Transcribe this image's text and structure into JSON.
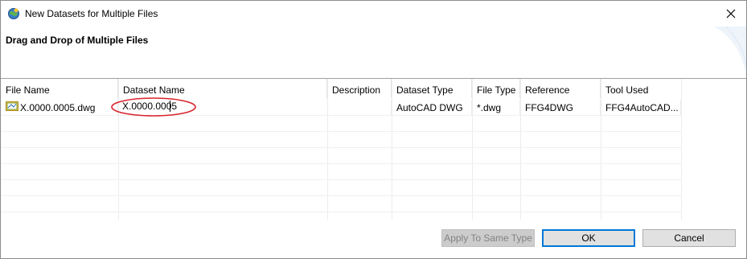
{
  "window": {
    "title": "New Datasets for Multiple Files",
    "icon": "globe-app-icon"
  },
  "header": {
    "title": "Drag and Drop of Multiple Files"
  },
  "table": {
    "columns": [
      "File Name",
      "Dataset Name",
      "Description",
      "Dataset Type",
      "File Type",
      "Reference",
      "Tool Used"
    ],
    "rows": [
      {
        "file_name": "X.0000.0005.dwg",
        "dataset_name": "X.0000.0005",
        "description": "",
        "dataset_type": "AutoCAD DWG",
        "file_type": "*.dwg",
        "reference": "FFG4DWG",
        "tool_used": "FFG4AutoCAD..."
      }
    ]
  },
  "buttons": {
    "apply": "Apply To Same Type",
    "ok": "OK",
    "cancel": "Cancel"
  },
  "colors": {
    "highlight_circle": "#d9232e",
    "ok_border": "#0078d7"
  }
}
